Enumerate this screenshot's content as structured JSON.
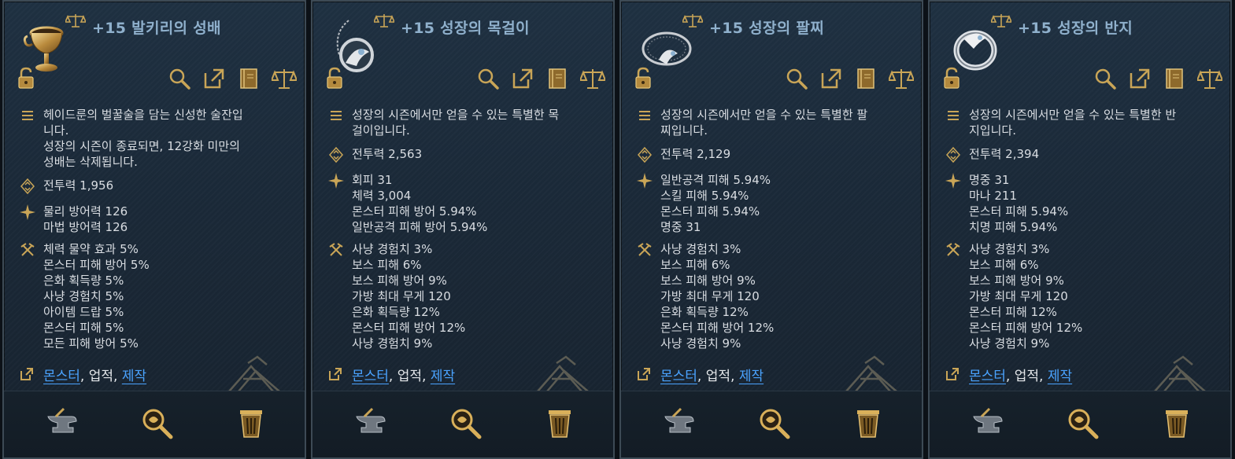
{
  "cards": [
    {
      "title": "+15 발키리의 성배",
      "item_icon": "chalice-icon",
      "description": [
        "헤이드룬의 벌꿀술을 담는 신성한 술잔입",
        "니다.",
        "성장의 시즌이 종료되면, 12강화 미만의",
        "성배는 삭제됩니다."
      ],
      "power": "전투력  1,956",
      "stats": [
        "물리 방어력  126",
        "마법 방어력  126"
      ],
      "bonus": [
        "체력 물약 효과  5%",
        "몬스터 피해 방어  5%",
        "은화 획득량  5%",
        "사냥 경험치  5%",
        "아이템 드랍  5%",
        "몬스터 피해  5%",
        "모든 피해 방어  5%"
      ],
      "source": {
        "link1": "몬스터",
        "sep1": ", ",
        "plain": "업적",
        "sep2": ", ",
        "link2": "제작"
      }
    },
    {
      "title": "+15 성장의 목걸이",
      "item_icon": "necklace-icon",
      "description": [
        "성장의 시즌에서만 얻을 수 있는 특별한 목",
        "걸이입니다."
      ],
      "power": "전투력  2,563",
      "stats": [
        "회피  31",
        "체력  3,004",
        "몬스터 피해 방어  5.94%",
        "일반공격 피해 방어  5.94%"
      ],
      "bonus": [
        "사냥 경험치  3%",
        "보스 피해  6%",
        "보스 피해 방어  9%",
        "가방 최대 무게  120",
        "은화 획득량  12%",
        "몬스터 피해 방어  12%",
        "사냥 경험치  9%"
      ],
      "source": {
        "link1": "몬스터",
        "sep1": ", ",
        "plain": "업적",
        "sep2": ", ",
        "link2": "제작"
      }
    },
    {
      "title": "+15 성장의 팔찌",
      "item_icon": "bracelet-icon",
      "description": [
        "성장의 시즌에서만 얻을 수 있는 특별한 팔",
        "찌입니다."
      ],
      "power": "전투력  2,129",
      "stats": [
        "일반공격 피해  5.94%",
        "스킬 피해  5.94%",
        "몬스터 피해  5.94%",
        "명중  31"
      ],
      "bonus": [
        "사냥 경험치  3%",
        "보스 피해  6%",
        "보스 피해 방어  9%",
        "가방 최대 무게  120",
        "은화 획득량  12%",
        "몬스터 피해 방어  12%",
        "사냥 경험치  9%"
      ],
      "source": {
        "link1": "몬스터",
        "sep1": ", ",
        "plain": "업적",
        "sep2": ", ",
        "link2": "제작"
      }
    },
    {
      "title": "+15 성장의 반지",
      "item_icon": "ring-icon",
      "description": [
        "성장의 시즌에서만 얻을 수 있는 특별한 반",
        "지입니다."
      ],
      "power": "전투력  2,394",
      "stats": [
        "명중  31",
        "마나  211",
        "몬스터 피해  5.94%",
        "치명 피해  5.94%"
      ],
      "bonus": [
        "사냥 경험치  3%",
        "보스 피해  6%",
        "보스 피해 방어  9%",
        "가방 최대 무게  120",
        "몬스터 피해  12%",
        "몬스터 피해 방어  12%",
        "사냥 경험치  9%"
      ],
      "source": {
        "link1": "몬스터",
        "sep1": ", ",
        "plain": "업적",
        "sep2": ", ",
        "link2": "제작"
      }
    }
  ],
  "toolbar_icons": [
    "magnifier-icon",
    "external-link-icon",
    "book-icon",
    "scale-icon"
  ],
  "footer_icons": [
    "anvil-icon",
    "appraise-icon",
    "trash-icon"
  ],
  "colors": {
    "title": "#8fb0cc",
    "link": "#4aa3ff",
    "gold": "#c9a557",
    "text": "#d9dde2"
  }
}
